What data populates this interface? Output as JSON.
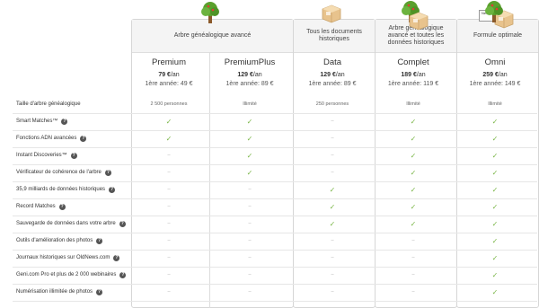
{
  "headers": [
    {
      "label": "Arbre généalogique avancé",
      "icon": "tree-icon"
    },
    {
      "label": "Tous les documents historiques",
      "icon": "box-icon"
    },
    {
      "label": "Arbre généalogique avancé et toutes les données historiques",
      "icon": "tree-box-icon"
    },
    {
      "label": "Formule optimale",
      "icon": "news-box-icon"
    }
  ],
  "plans": [
    {
      "name": "Premium",
      "price": "79 €",
      "per": "/an",
      "first_year": "1ère année: 49 €"
    },
    {
      "name": "PremiumPlus",
      "price": "129 €",
      "per": "/an",
      "first_year": "1ère année: 89 €"
    },
    {
      "name": "Data",
      "price": "129 €",
      "per": "/an",
      "first_year": "1ère année: 89 €"
    },
    {
      "name": "Complet",
      "price": "189 €",
      "per": "/an",
      "first_year": "1ère année: 119 €"
    },
    {
      "name": "Omni",
      "price": "259 €",
      "per": "/an",
      "first_year": "1ère année: 149 €"
    }
  ],
  "features": [
    {
      "label": "Taille d'arbre généalogique",
      "help": false,
      "values": [
        "2 500 personnes",
        "Illimité",
        "250 personnes",
        "Illimité",
        "Illimité"
      ]
    },
    {
      "label": "Smart Matches™",
      "help": true,
      "values": [
        "check",
        "check",
        "-",
        "check",
        "check"
      ]
    },
    {
      "label": "Fonctions ADN avancées",
      "help": true,
      "values": [
        "check",
        "check",
        "-",
        "check",
        "check"
      ]
    },
    {
      "label": "Instant Discoveries™",
      "help": true,
      "values": [
        "-",
        "check",
        "-",
        "check",
        "check"
      ]
    },
    {
      "label": "Vérificateur de cohérence de l'arbre",
      "help": true,
      "values": [
        "-",
        "check",
        "-",
        "check",
        "check"
      ]
    },
    {
      "label": "35,9 milliards de données historiques",
      "help": true,
      "values": [
        "-",
        "-",
        "check",
        "check",
        "check"
      ]
    },
    {
      "label": "Record Matches",
      "help": true,
      "values": [
        "-",
        "-",
        "check",
        "check",
        "check"
      ]
    },
    {
      "label": "Sauvegarde de données dans votre arbre",
      "help": true,
      "values": [
        "-",
        "-",
        "check",
        "check",
        "check"
      ]
    },
    {
      "label": "Outils d'amélioration des photos",
      "help": true,
      "values": [
        "-",
        "-",
        "-",
        "-",
        "check"
      ]
    },
    {
      "label": "Journaux historiques sur OldNews.com",
      "help": true,
      "values": [
        "-",
        "-",
        "-",
        "-",
        "check"
      ]
    },
    {
      "label": "Geni.com Pro et plus de 2 000 webinaires",
      "help": true,
      "values": [
        "-",
        "-",
        "-",
        "-",
        "check"
      ]
    },
    {
      "label": "Numérisation illimitée de photos",
      "help": true,
      "values": [
        "-",
        "-",
        "-",
        "-",
        "check"
      ]
    }
  ],
  "help_glyph": "?",
  "check_glyph": "✓",
  "dash_glyph": "–",
  "news_label": "News",
  "colors": {
    "check": "#7ab648",
    "tree": "#5aa02c",
    "box": "#e8c38d"
  }
}
